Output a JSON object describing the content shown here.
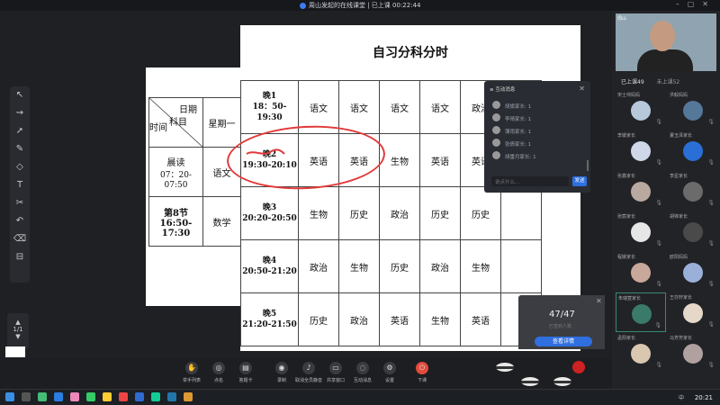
{
  "titlebar": {
    "title": "周山发起的在线课堂 | 已上课 00:22:44"
  },
  "back_sheet": {
    "header_day": "日期",
    "header_subject": "科目",
    "header_time": "时间",
    "header_monday": "星期一",
    "row1_period": "晨读",
    "row1_time": "07：20-07:50",
    "row1_subject": "语文",
    "row2_period": "第8节",
    "row2_time": "16:50-17:30",
    "row2_subject": "数学"
  },
  "schedule": {
    "title": "自习分科分时",
    "rows": [
      {
        "period": "晚1",
        "time": "18：50-19:30",
        "cells": [
          "语文",
          "语文",
          "语文",
          "语文",
          "政治",
          ""
        ]
      },
      {
        "period": "晚2",
        "time": "19:30-20:10",
        "cells": [
          "英语",
          "英语",
          "生物",
          "英语",
          "英语",
          ""
        ]
      },
      {
        "period": "晚3",
        "time": "20:20-20:50",
        "cells": [
          "生物",
          "历史",
          "政治",
          "历史",
          "历史",
          ""
        ]
      },
      {
        "period": "晚4",
        "time": "20:50-21:20",
        "cells": [
          "政治",
          "生物",
          "历史",
          "政治",
          "生物",
          ""
        ]
      },
      {
        "period": "晚5",
        "time": "21:20-21:50",
        "cells": [
          "历史",
          "政治",
          "英语",
          "生物",
          "英语",
          ""
        ]
      }
    ]
  },
  "chat": {
    "header": "互动消息",
    "messages": [
      "胡旗家长: 1",
      "李晴家长: 1",
      "薄雨家长: 1",
      "张倩家长: 1",
      "胡雷月家长: 1"
    ],
    "input_placeholder": "说点什么...",
    "send_label": "发送"
  },
  "sign_in": {
    "count": "47/47",
    "sub": "已签到人数",
    "button": "查看详情"
  },
  "toolbar": {
    "items": [
      "举手列表",
      "点名",
      "答题卡",
      "录制",
      "取消全员静音",
      "共享窗口",
      "互动消息",
      "设置",
      "下课"
    ]
  },
  "page_indicator": "1/1",
  "teacher_cam": {
    "name": "周山"
  },
  "roster": {
    "tab_active": "已上课49",
    "tab_inactive": "未上课52",
    "students": [
      "宋士帅妈妈",
      "洪毅妈妈",
      "李媛家长",
      "董玉泽家长",
      "张鑫家长",
      "李星家长",
      "张宸家长",
      "胡锋家长",
      "程媛家长",
      "欧阳妈妈",
      "朱瑞萱家长",
      "王亦轩家长",
      "孟阳家长",
      "马芳芳家长"
    ]
  },
  "taskbar": {
    "clock": "20:21",
    "ime": "中"
  }
}
